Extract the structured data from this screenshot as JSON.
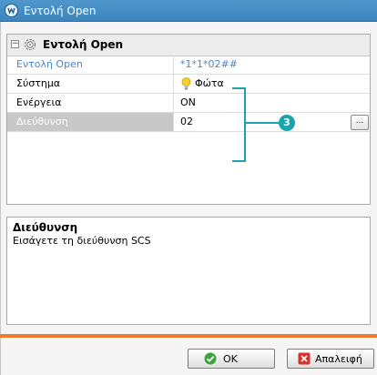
{
  "window": {
    "title": "Εντολή Open"
  },
  "grid": {
    "header_title": "Εντολή Open",
    "rows": [
      {
        "label": "Εντολή Open",
        "value": "*1*1*02##"
      },
      {
        "label": "Σύστημα",
        "value": "Φώτα",
        "icon": "bulb-icon"
      },
      {
        "label": "Ενέργεια",
        "value": "ON"
      },
      {
        "label": "Διεύθυνση",
        "value": "02",
        "browse_label": "..."
      }
    ]
  },
  "annotation": {
    "badge": "3",
    "color": "#1aa4b0"
  },
  "description": {
    "title": "Διεύθυνση",
    "text": "Εισάγετε τη διεύθυνση SCS"
  },
  "buttons": {
    "ok_label": "OK",
    "cancel_label": "Απαλειφή"
  },
  "colors": {
    "titlebar": "#3b84bd",
    "accent_bar": "#ee7a2b",
    "link_text": "#4a86c5"
  }
}
